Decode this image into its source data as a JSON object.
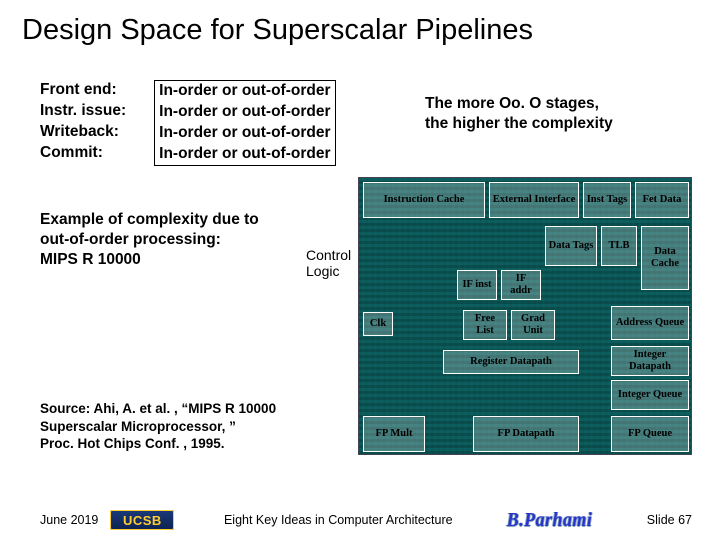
{
  "title": "Design Space for Superscalar Pipelines",
  "stages": {
    "labels": [
      "Front end:",
      "Instr. issue:",
      "Writeback:",
      "Commit:"
    ],
    "values": [
      "In-order or out-of-order",
      "In-order or out-of-order",
      "In-order or out-of-order",
      "In-order or out-of-order"
    ]
  },
  "note_line1": "The more Oo. O stages,",
  "note_line2": "the higher the complexity",
  "example_line1": "Example of complexity due to",
  "example_line2": "out-of-order processing:",
  "example_line3": "MIPS R 10000",
  "control_logic_label": "Control\nLogic",
  "chip_blocks": {
    "instr_cache": "Instruction Cache",
    "ext_if": "External Interface",
    "inst_tags": "Inst Tags",
    "fet_data": "Fet Data",
    "data_tags": "Data Tags",
    "tlb": "TLB",
    "data_cache": "Data Cache",
    "if_inst": "IF inst",
    "if_addr": "IF addr",
    "clk": "Clk",
    "free_list": "Free List",
    "grad_unit": "Grad Unit",
    "addr_queue": "Address Queue",
    "reg_datapath": "Register Datapath",
    "int_datapath": "Integer Datapath",
    "int_queue": "Integer Queue",
    "fp_mult": "FP Mult",
    "fp_datapath": "FP Datapath",
    "fp_queue": "FP Queue"
  },
  "source_line1": "Source: Ahi, A. et al. , “MIPS R 10000",
  "source_line2": "Superscalar Microprocessor, ”",
  "source_line3": "Proc. Hot Chips Conf. , 1995.",
  "footer": {
    "date": "June 2019",
    "logo_text": "UCSB",
    "center": "Eight Key Ideas in Computer Architecture",
    "author": "B.Parhami",
    "slide": "Slide 67"
  }
}
